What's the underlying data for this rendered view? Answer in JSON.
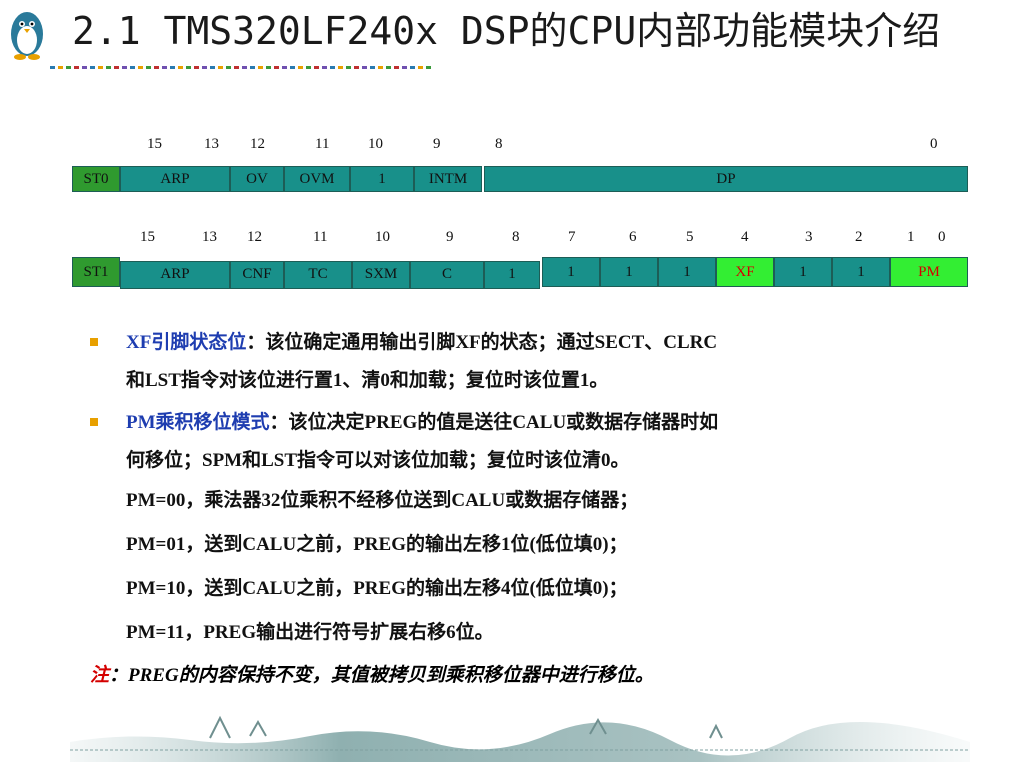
{
  "title": "2.1  TMS320LF240x DSP的CPU内部功能模块介绍",
  "colors": {
    "teal": "#18908a",
    "green": "#2f9a2f",
    "lime": "#33ee33",
    "red": "#d40000",
    "blue": "#1e3db0",
    "bullet": "#e8a000"
  },
  "st0": {
    "bitnums": [
      "15",
      "13",
      "12",
      "11",
      "10",
      "9",
      "8",
      "0"
    ],
    "cells": [
      "ST0",
      "ARP",
      "OV",
      "OVM",
      "1",
      "INTM",
      "DP"
    ]
  },
  "st1": {
    "bitnums": [
      "15",
      "13",
      "12",
      "11",
      "10",
      "9",
      "8",
      "7",
      "6",
      "5",
      "4",
      "3",
      "2",
      "1",
      "0"
    ],
    "cells": [
      "ST1",
      "ARP",
      "CNF",
      "TC",
      "SXM",
      "C",
      "1",
      "1",
      "1",
      "1",
      "XF",
      "1",
      "1",
      "PM"
    ]
  },
  "bullets": [
    {
      "term": "XF引脚状态位",
      "line1": "：该位确定通用输出引脚XF的状态；通过SECT、CLRC",
      "line2": "和LST指令对该位进行置1、清0和加载；复位时该位置1。"
    },
    {
      "term": "PM乘积移位模式",
      "line1": "：该位决定PREG的值是送往CALU或数据存储器时如",
      "line2": "何移位；SPM和LST指令可以对该位加载；复位时该位清0。"
    }
  ],
  "pm_lines": [
    "PM=00，乘法器32位乘积不经移位送到CALU或数据存储器；",
    "PM=01，送到CALU之前，PREG的输出左移1位(低位填0)；",
    "PM=10，送到CALU之前，PREG的输出左移4位(低位填0)；",
    "PM=11，PREG输出进行符号扩展右移6位。"
  ],
  "note": {
    "label": "注",
    "text": "：PREG的内容保持不变，其值被拷贝到乘积移位器中进行移位。"
  }
}
